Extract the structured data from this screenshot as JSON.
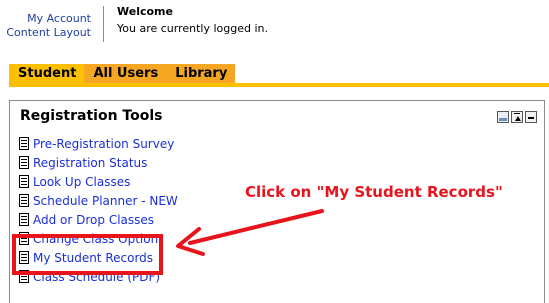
{
  "account_links": {
    "my_account": "My Account",
    "content_layout": "Content Layout"
  },
  "welcome": {
    "title": "Welcome",
    "message": "You are currently logged in."
  },
  "tabs": [
    {
      "label": "Student",
      "active": true
    },
    {
      "label": "All Users",
      "active": false
    },
    {
      "label": "Library",
      "active": false
    }
  ],
  "panel": {
    "title": "Registration Tools",
    "links": [
      {
        "label": "Pre-Registration Survey"
      },
      {
        "label": "Registration Status"
      },
      {
        "label": "Look Up Classes"
      },
      {
        "label": "Schedule Planner - NEW"
      },
      {
        "label": "Add or Drop Classes"
      },
      {
        "label": "Change Class Option"
      },
      {
        "label": "My Student Records"
      },
      {
        "label": "Class Schedule (PDF)"
      }
    ]
  },
  "annotation": {
    "text": "Click on \"My Student Records\"",
    "color": "#e8141c"
  },
  "colors": {
    "tab_active": "#fcc000",
    "tab_inactive": "#f5a623",
    "link": "#1a2fd8"
  }
}
